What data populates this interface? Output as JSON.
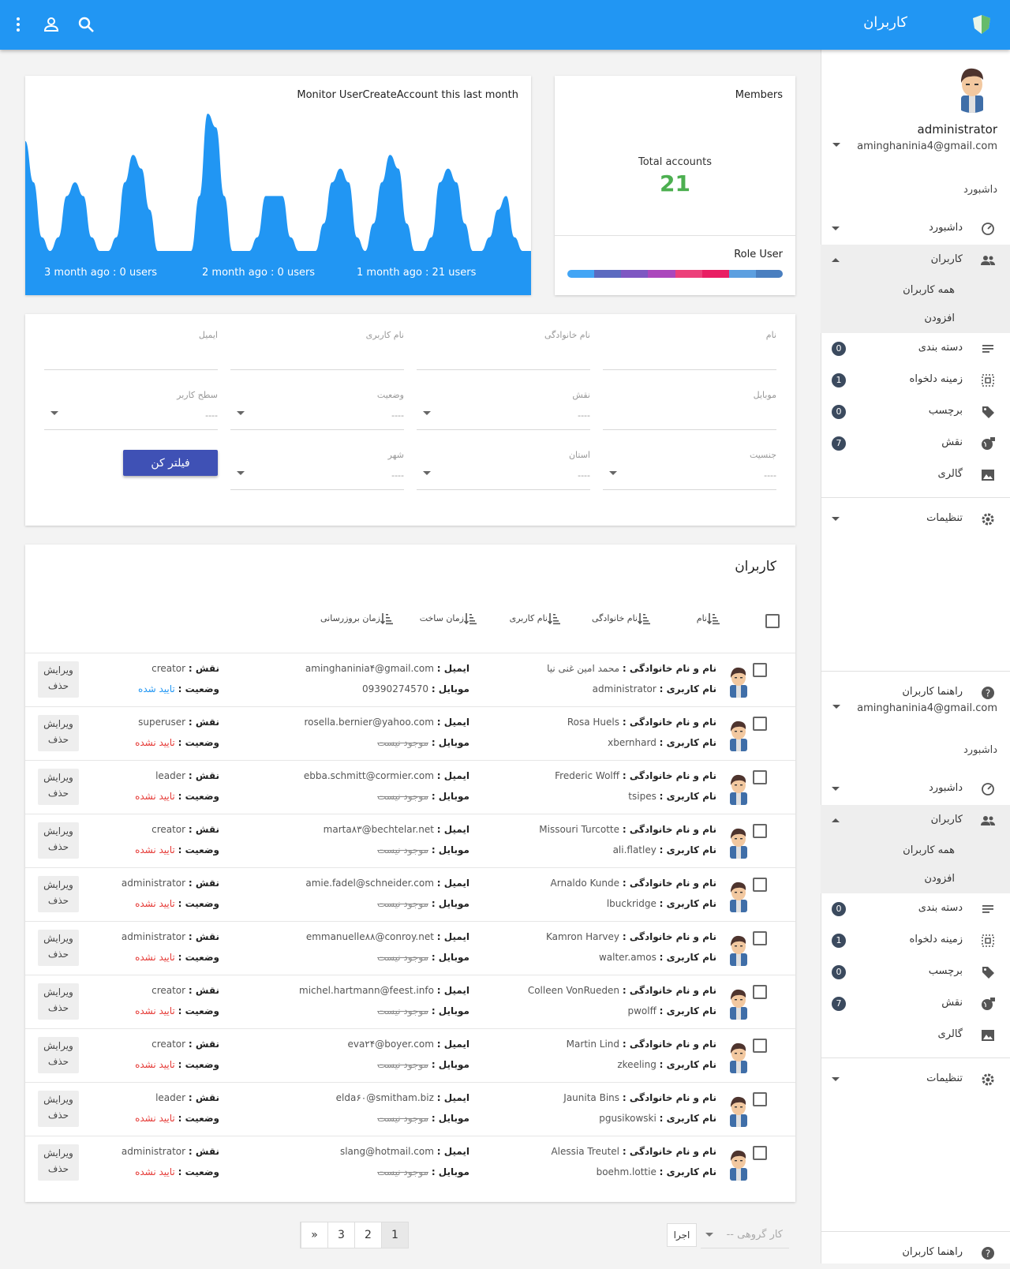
{
  "topbar": {
    "title": "کاربران"
  },
  "sidebar": {
    "user_name": "administrator",
    "user_email": "aminghaninia4@gmail.com",
    "section_label": "داشبورد",
    "items": [
      {
        "label": "داشبورد"
      },
      {
        "label": "کاربران"
      },
      {
        "label": "دسته بندی",
        "badge": "0"
      },
      {
        "label": "زمینه دلخواه",
        "badge": "1"
      },
      {
        "label": "برچسب",
        "badge": "0"
      },
      {
        "label": "نقش",
        "badge": "7"
      },
      {
        "label": "گالری"
      },
      {
        "label": "تنظیمات"
      }
    ],
    "sub_items": [
      {
        "label": "همه کاربران"
      },
      {
        "label": "افزودن"
      }
    ],
    "guide_label": "راهنما کاربران"
  },
  "chart": {
    "title": "Monitor UserCreateAccount this last month",
    "footer": [
      "3 month ago : 0 users",
      "2 month ago : 0 users",
      "1 month ago : 21 users"
    ]
  },
  "chart_data": {
    "type": "area",
    "title": "Monitor UserCreateAccount this last month",
    "x": [
      1,
      2,
      3,
      4,
      5,
      6,
      7,
      8,
      9,
      10,
      11,
      12,
      13,
      14,
      15,
      16,
      17,
      18,
      19,
      20,
      21,
      22,
      23,
      24,
      25,
      26,
      27,
      28,
      29,
      30,
      31,
      32,
      33,
      34,
      35,
      36,
      37,
      38,
      39,
      40,
      41,
      42,
      43,
      44,
      45,
      46,
      47,
      48,
      49,
      50,
      51,
      52,
      53,
      54,
      55,
      56,
      57,
      58,
      59,
      60,
      61,
      62
    ],
    "values": [
      8,
      5,
      1,
      0,
      1,
      4,
      5,
      4,
      1,
      0,
      0,
      1,
      5,
      7,
      6,
      3,
      0,
      0,
      0,
      0,
      0,
      4,
      10,
      9,
      4,
      0,
      0,
      0,
      1,
      4,
      4,
      4,
      1,
      0,
      0,
      0,
      2,
      5,
      6,
      5,
      1,
      0,
      2,
      5,
      7,
      6,
      2,
      0,
      0,
      1,
      5,
      6,
      5,
      2,
      0,
      0,
      1,
      3,
      4,
      1,
      0,
      0
    ],
    "ylim": [
      0,
      10
    ],
    "color": "#2196f3"
  },
  "members": {
    "title": "Members",
    "total_label": "Total accounts",
    "total_value": "21",
    "role_label": "Role User",
    "role_colors": [
      "#42a5f5",
      "#5c6bc0",
      "#7e57c2",
      "#ab47bc",
      "#ec407a",
      "#e91e63",
      "#5c9fe0",
      "#4a7fc0"
    ]
  },
  "filter": {
    "fields": [
      {
        "label": "نام",
        "value": ""
      },
      {
        "label": "نام خانوادگی",
        "value": ""
      },
      {
        "label": "نام کاربری",
        "value": ""
      },
      {
        "label": "ایمیل",
        "value": ""
      },
      {
        "label": "موبایل",
        "value": ""
      },
      {
        "label": "نقش",
        "value": "----"
      },
      {
        "label": "وضعیت",
        "value": "----"
      },
      {
        "label": "سطح کاربر",
        "value": "----"
      },
      {
        "label": "جنسیت",
        "value": "----"
      },
      {
        "label": "استان",
        "value": "----"
      },
      {
        "label": "شهر",
        "value": "----"
      }
    ],
    "button": "فیلتر کن"
  },
  "table": {
    "title": "کاربران",
    "columns": [
      "نام",
      "نام خانوادگی",
      "نام کاربری",
      "زمان ساخت",
      "زمان بروزرسانی"
    ],
    "labels": {
      "fullname": "نام و نام خانوادگی :",
      "username": "نام کاربری :",
      "email": "ایمیل :",
      "mobile": "موبایل :",
      "role": "نقش :",
      "status": "وضعیت :",
      "edit": "ویرایش",
      "delete": "حذف"
    },
    "rows": [
      {
        "fullname": "محمد امین غنی نیا",
        "username": "administrator",
        "email": "aminghaninia۴@gmail.com",
        "mobile": "09390274570",
        "mobile_missing": false,
        "role": "creator",
        "status": "تایید شده",
        "ok": true
      },
      {
        "fullname": "Rosa Huels",
        "username": "xbernhard",
        "email": "rosella.bernier@yahoo.com",
        "mobile": "موجود نیست",
        "mobile_missing": true,
        "role": "superuser",
        "status": "تایید نشده",
        "ok": false
      },
      {
        "fullname": "Frederic Wolff",
        "username": "tsipes",
        "email": "ebba.schmitt@cormier.com",
        "mobile": "موجود نیست",
        "mobile_missing": true,
        "role": "leader",
        "status": "تایید نشده",
        "ok": false
      },
      {
        "fullname": "Missouri Turcotte",
        "username": "ali.flatley",
        "email": "marta۸۳@bechtelar.net",
        "mobile": "موجود نیست",
        "mobile_missing": true,
        "role": "creator",
        "status": "تایید نشده",
        "ok": false
      },
      {
        "fullname": "Arnaldo Kunde",
        "username": "lbuckridge",
        "email": "amie.fadel@schneider.com",
        "mobile": "موجود نیست",
        "mobile_missing": true,
        "role": "administrator",
        "status": "تایید نشده",
        "ok": false
      },
      {
        "fullname": "Kamron Harvey",
        "username": "walter.amos",
        "email": "emmanuelle۸۸@conroy.net",
        "mobile": "موجود نیست",
        "mobile_missing": true,
        "role": "administrator",
        "status": "تایید نشده",
        "ok": false
      },
      {
        "fullname": "Colleen VonRueden",
        "username": "pwolff",
        "email": "michel.hartmann@feest.info",
        "mobile": "موجود نیست",
        "mobile_missing": true,
        "role": "creator",
        "status": "تایید نشده",
        "ok": false
      },
      {
        "fullname": "Martin Lind",
        "username": "zkeeling",
        "email": "eva۲۴@boyer.com",
        "mobile": "موجود نیست",
        "mobile_missing": true,
        "role": "creator",
        "status": "تایید نشده",
        "ok": false
      },
      {
        "fullname": "Jaunita Bins",
        "username": "pgusikowski",
        "email": "elda۶۰@smitham.biz",
        "mobile": "موجود نیست",
        "mobile_missing": true,
        "role": "leader",
        "status": "تایید نشده",
        "ok": false
      },
      {
        "fullname": "Alessia Treutel",
        "username": "boehm.lottie",
        "email": "slang@hotmail.com",
        "mobile": "موجود نیست",
        "mobile_missing": true,
        "role": "administrator",
        "status": "تایید نشده",
        "ok": false
      }
    ]
  },
  "pagination": {
    "pages": [
      "»",
      "3",
      "2",
      "1"
    ],
    "current": "1"
  },
  "bulk": {
    "placeholder": "-- کار گروهی",
    "run": "اجرا"
  }
}
